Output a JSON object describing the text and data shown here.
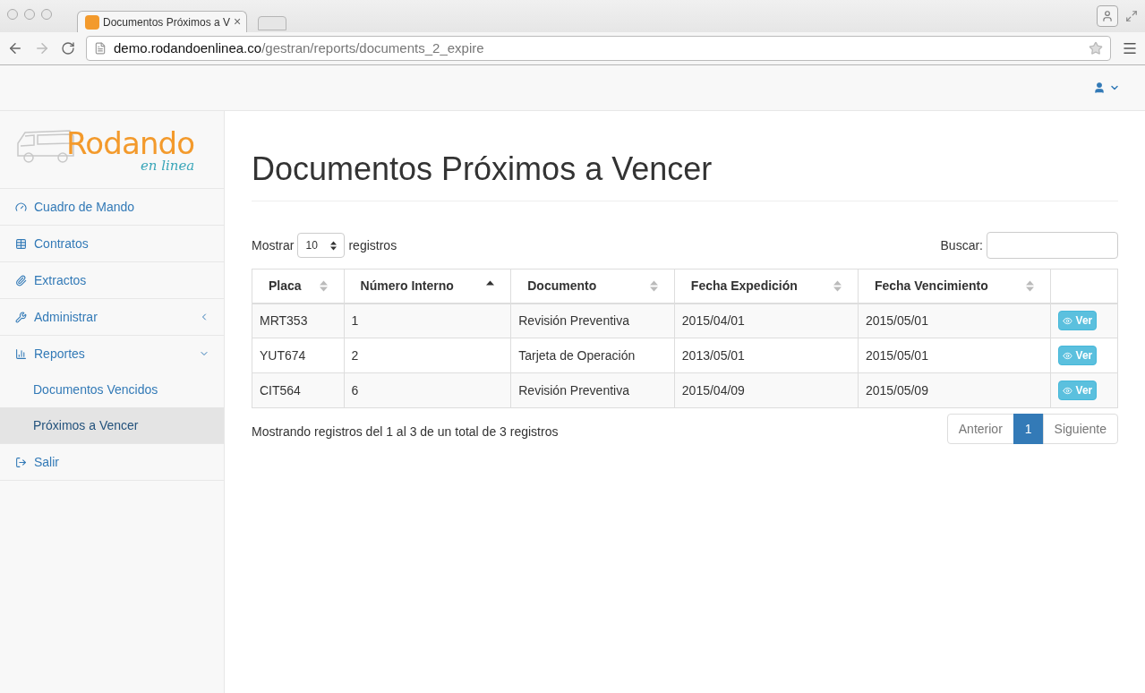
{
  "browser": {
    "tab_title": "Documentos Próximos a V",
    "tab_close": "×",
    "url_host": "demo.rodandoenlinea.co",
    "url_path": "/gestran/reports/documents_2_expire"
  },
  "logo": {
    "name": "Rodando",
    "tagline": "en linea"
  },
  "sidebar": {
    "items": [
      {
        "label": "Cuadro de Mando",
        "selected": false
      },
      {
        "label": "Contratos",
        "selected": false
      },
      {
        "label": "Extractos",
        "selected": false
      },
      {
        "label": "Administrar",
        "selected": false,
        "expanded": false
      },
      {
        "label": "Reportes",
        "selected": false,
        "expanded": true,
        "children": [
          {
            "label": "Documentos Vencidos",
            "selected": false
          },
          {
            "label": "Próximos a Vencer",
            "selected": true
          }
        ]
      },
      {
        "label": "Salir",
        "selected": false
      }
    ]
  },
  "page": {
    "title": "Documentos Próximos a Vencer"
  },
  "table_controls": {
    "show_label": "Mostrar",
    "page_size": "10",
    "records_label": "registros",
    "search_label": "Buscar:"
  },
  "table": {
    "columns": [
      {
        "label": "Placa",
        "sorted": false
      },
      {
        "label": "Número Interno",
        "sorted": true
      },
      {
        "label": "Documento",
        "sorted": false
      },
      {
        "label": "Fecha Expedición",
        "sorted": false
      },
      {
        "label": "Fecha Vencimiento",
        "sorted": false
      }
    ],
    "rows": [
      {
        "cells": [
          "MRT353",
          "1",
          "Revisión Preventiva",
          "2015/04/01",
          "2015/05/01"
        ],
        "action": "Ver"
      },
      {
        "cells": [
          "YUT674",
          "2",
          "Tarjeta de Operación",
          "2013/05/01",
          "2015/05/01"
        ],
        "action": "Ver"
      },
      {
        "cells": [
          "CIT564",
          "6",
          "Revisión Preventiva",
          "2015/04/09",
          "2015/05/09"
        ],
        "action": "Ver"
      }
    ]
  },
  "footer": {
    "info": "Mostrando registros del 1 al 3 de un total de 3 registros",
    "pagination": [
      {
        "label": "Anterior",
        "selected": false
      },
      {
        "label": "1",
        "selected": true
      },
      {
        "label": "Siguiente",
        "selected": false
      }
    ]
  }
}
